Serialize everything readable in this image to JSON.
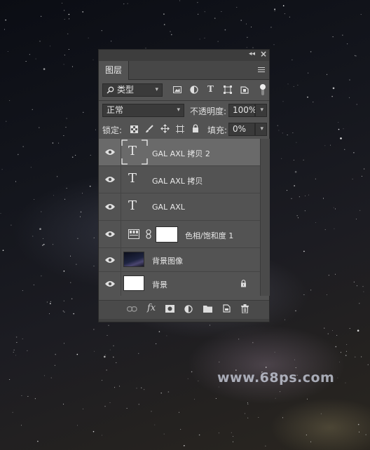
{
  "panel": {
    "tab_label": "图层",
    "filter": {
      "value": "类型"
    },
    "blend_mode": {
      "value": "正常"
    },
    "opacity": {
      "label": "不透明度:",
      "value": "100%"
    },
    "lock": {
      "label": "锁定:"
    },
    "fill": {
      "label": "填充:",
      "value": "0%"
    },
    "layers": [
      {
        "name": "GAL AXL 拷贝 2",
        "kind": "text",
        "selected": true
      },
      {
        "name": "GAL AXL 拷贝",
        "kind": "text",
        "selected": false
      },
      {
        "name": "GAL AXL",
        "kind": "text",
        "selected": false
      },
      {
        "name": "色相/饱和度 1",
        "kind": "adjustment",
        "selected": false
      },
      {
        "name": "背景图像",
        "kind": "image",
        "selected": false
      },
      {
        "name": "背景",
        "kind": "background",
        "selected": false,
        "locked": true
      }
    ],
    "text_glyph": "T",
    "bottom_icons": [
      "link-icon",
      "fx-icon",
      "mask-icon",
      "adjustment-icon",
      "folder-icon",
      "new-layer-icon",
      "trash-icon"
    ],
    "fx_label": "fx"
  },
  "watermark": "www.68ps.com",
  "colors": {
    "panel_bg": "#535353",
    "selected_row": "#6a6a6a",
    "dark_bar": "#3d3d3d"
  }
}
